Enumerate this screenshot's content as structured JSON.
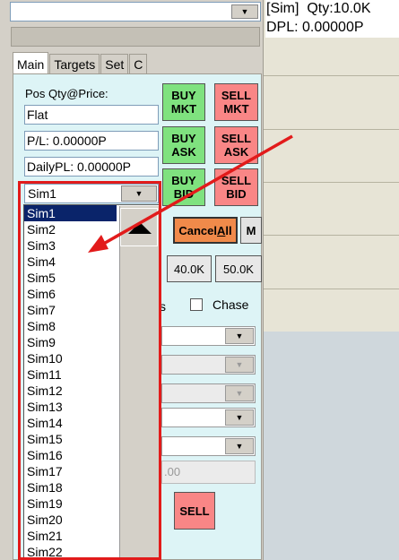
{
  "header": {
    "info_line1": "[Sim]  Qty:10.0K",
    "info_line2": "DPL: 0.00000P"
  },
  "tabs": [
    "Main",
    "Targets",
    "Set",
    "C"
  ],
  "position": {
    "label": "Pos Qty@Price:",
    "value": "Flat",
    "pl": "P/L: 0.00000P",
    "daily_pl": "DailyPL: 0.00000P"
  },
  "buttons": {
    "buy_mkt": "BUY MKT",
    "sell_mkt": "SELL MKT",
    "buy_ask": "BUY ASK",
    "sell_ask": "SELL ASK",
    "buy_bid": "BUY BID",
    "sell_bid": "SELL BID",
    "cancel_all": "CancelAll",
    "m": "M",
    "qty_40k": "40.0K",
    "qty_50k": "50.0K",
    "sell": "SELL"
  },
  "chase": {
    "partial_text": "s",
    "label": "Chase"
  },
  "price_field": ".00",
  "account_dropdown": {
    "selected": "Sim1",
    "items": [
      "Sim1",
      "Sim2",
      "Sim3",
      "Sim4",
      "Sim5",
      "Sim6",
      "Sim7",
      "Sim8",
      "Sim9",
      "Sim10",
      "Sim11",
      "Sim12",
      "Sim13",
      "Sim14",
      "Sim15",
      "Sim16",
      "Sim17",
      "Sim18",
      "Sim19",
      "Sim20",
      "Sim21",
      "Sim22"
    ]
  },
  "colors": {
    "buy": "#7fe27f",
    "sell": "#f98686",
    "cancel": "#f08a4a",
    "highlight": "#e21b1b",
    "selected_item": "#0a246a"
  }
}
